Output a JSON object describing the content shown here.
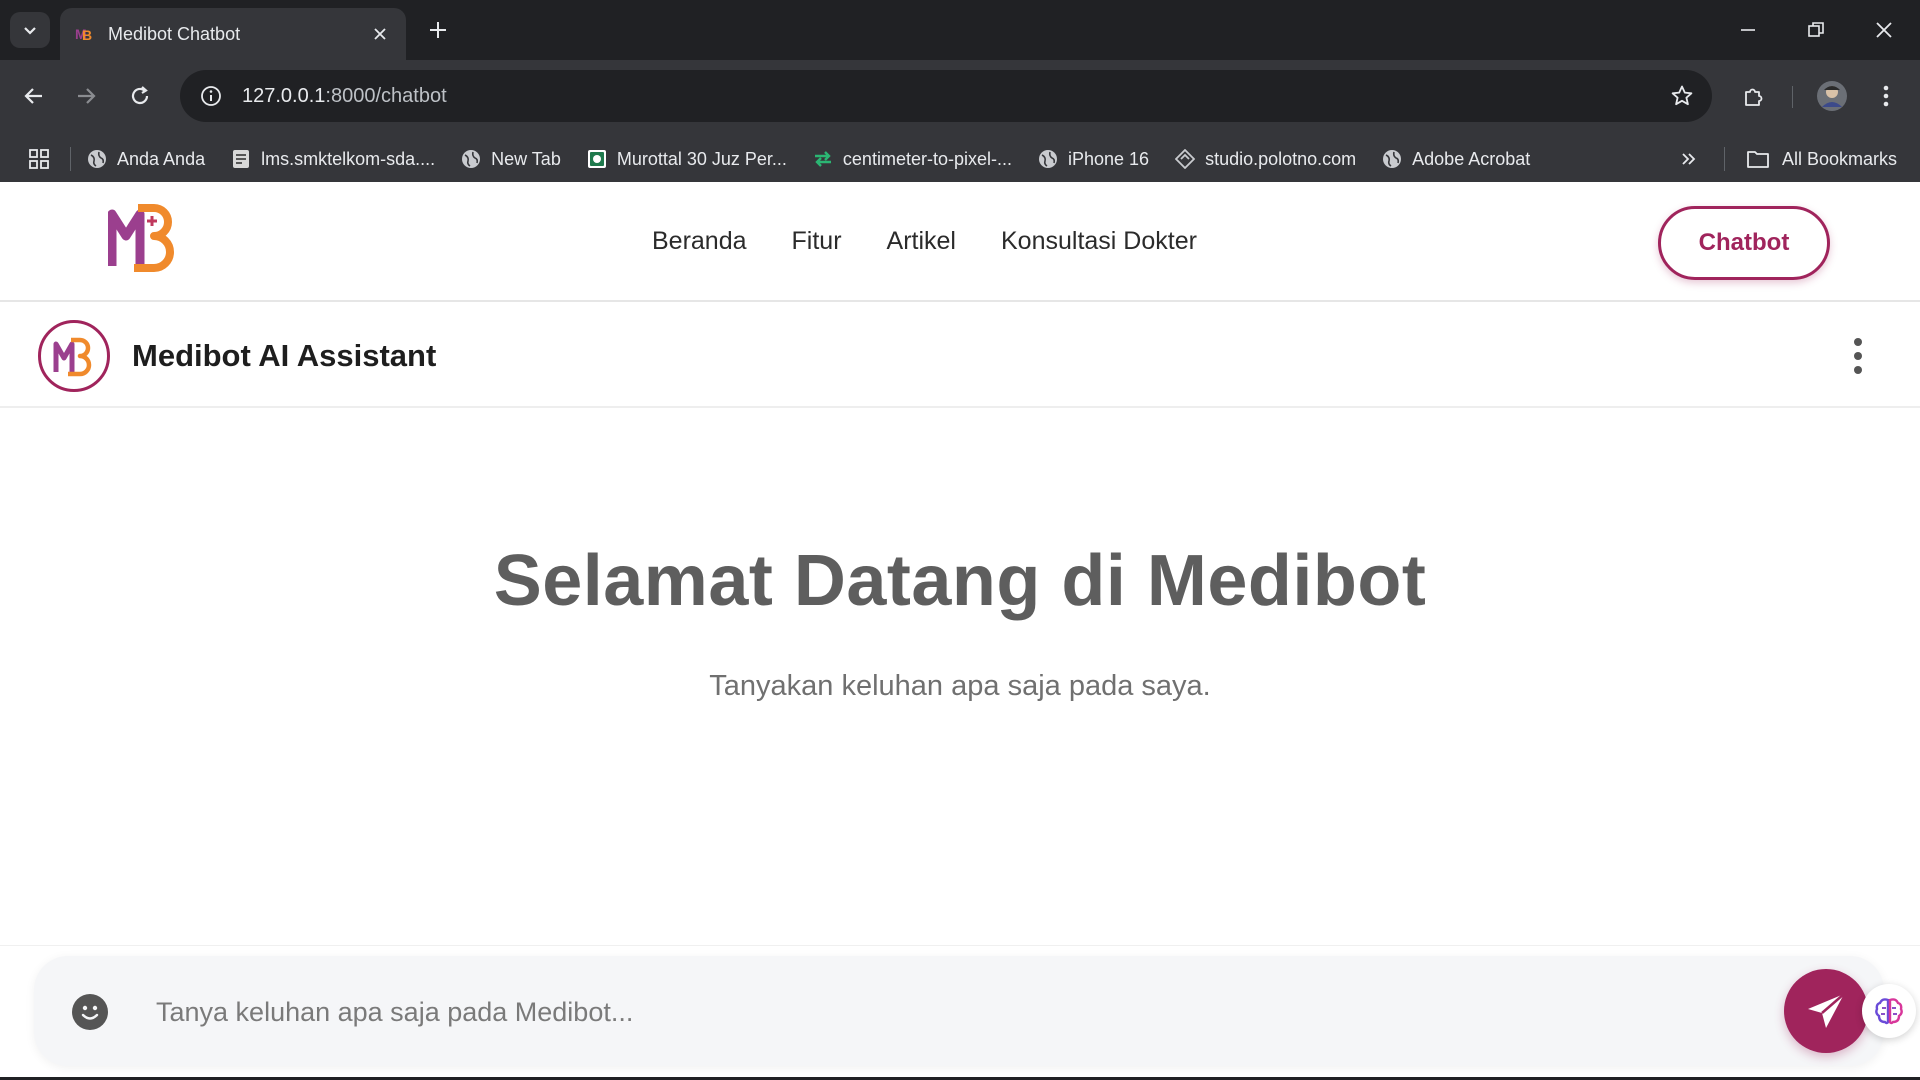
{
  "browser": {
    "tab_title": "Medibot Chatbot",
    "url_host": "127.0.0.1",
    "url_path": ":8000/chatbot",
    "bookmarks": [
      {
        "label": "Anda Anda",
        "icon": "globe-icon"
      },
      {
        "label": "lms.smktelkom-sda....",
        "icon": "page-icon"
      },
      {
        "label": "New Tab",
        "icon": "globe-icon"
      },
      {
        "label": "Murottal 30 Juz Per...",
        "icon": "green-badge-icon"
      },
      {
        "label": "centimeter-to-pixel-...",
        "icon": "arrows-icon"
      },
      {
        "label": "iPhone 16",
        "icon": "globe-icon"
      },
      {
        "label": "studio.polotno.com",
        "icon": "polotno-icon"
      },
      {
        "label": "Adobe Acrobat",
        "icon": "globe-icon"
      }
    ],
    "all_bookmarks": "All Bookmarks"
  },
  "site": {
    "nav": [
      "Beranda",
      "Fitur",
      "Artikel",
      "Konsultasi Dokter"
    ],
    "cta": "Chatbot"
  },
  "chat": {
    "assistant_name": "Medibot AI Assistant",
    "welcome_title": "Selamat Datang di Medibot",
    "welcome_subtitle": "Tanyakan keluhan apa saja pada saya.",
    "input_placeholder": "Tanya keluhan apa saja pada Medibot..."
  },
  "colors": {
    "accent": "#a0245c",
    "logo_purple": "#9b3f8e",
    "logo_orange": "#f08a2c"
  }
}
